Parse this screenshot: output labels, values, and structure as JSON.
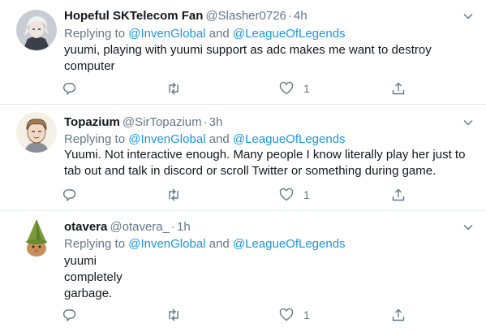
{
  "tweets": [
    {
      "name": "Hopeful SKTelecom Fan",
      "handle": "@Slasher0726",
      "sep": "·",
      "time": "4h",
      "replying_prefix": "Replying to",
      "mention1": "@InvenGlobal",
      "conj": "and",
      "mention2": "@LeagueOfLegends",
      "lines": [
        "yuumi, playing with yuumi support as adc makes me want to destroy",
        "computer"
      ],
      "like_count": "1"
    },
    {
      "name": "Topazium",
      "handle": "@SirTopazium",
      "sep": "·",
      "time": "3h",
      "replying_prefix": "Replying to",
      "mention1": "@InvenGlobal",
      "conj": "and",
      "mention2": "@LeagueOfLegends",
      "lines": [
        "Yuumi. Not interactive enough. Many people I know literally play her just to",
        "tab out and talk in discord or scroll Twitter or something during game."
      ],
      "like_count": "1"
    },
    {
      "name": "otavera",
      "handle": "@otavera_",
      "sep": "·",
      "time": "1h",
      "replying_prefix": "Replying to",
      "mention1": "@InvenGlobal",
      "conj": "and",
      "mention2": "@LeagueOfLegends",
      "lines": [
        "yuumi",
        "completely",
        "garbage."
      ],
      "like_count": "1"
    }
  ],
  "colors": {
    "text": "#14171a",
    "secondary": "#657786",
    "link": "#1b95e0",
    "divider": "#e6ecf0"
  },
  "icons": {
    "reply": "reply-icon",
    "retweet": "retweet-icon",
    "like": "heart-icon",
    "share": "share-icon",
    "more": "chevron-down-icon"
  }
}
